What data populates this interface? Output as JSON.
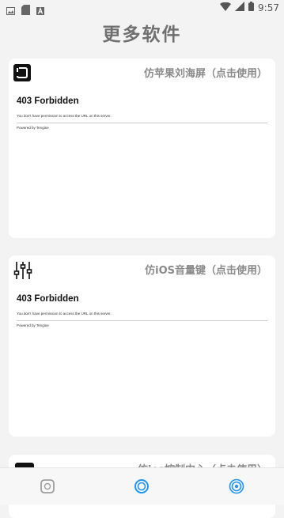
{
  "status_bar": {
    "time": "9:57"
  },
  "page": {
    "title": "更多软件"
  },
  "cards": [
    {
      "title": "仿苹果刘海屏（点击使用）",
      "icon": "rounded-square-app-icon",
      "error_heading": "403 Forbidden",
      "error_message": "You don't have permission to access the URL on this server.",
      "error_footer": "Powered by Tengine"
    },
    {
      "title": "仿iOS音量键（点击使用）",
      "icon": "sliders-icon",
      "error_heading": "403 Forbidden",
      "error_message": "You don't have permission to access the URL on this server.",
      "error_footer": "Powered by Tengine"
    },
    {
      "title": "仿ios控制中心（点击使用）",
      "icon": "app-icon"
    }
  ],
  "bottom_nav": {
    "items": [
      {
        "icon": "nav-icon-left",
        "color": "#9e9e9e"
      },
      {
        "icon": "nav-icon-center",
        "color": "#2196f3"
      },
      {
        "icon": "nav-icon-right",
        "color": "#2196f3"
      }
    ]
  },
  "colors": {
    "background": "#f3f3f3",
    "accent": "#2196f3",
    "title": "#707070"
  }
}
